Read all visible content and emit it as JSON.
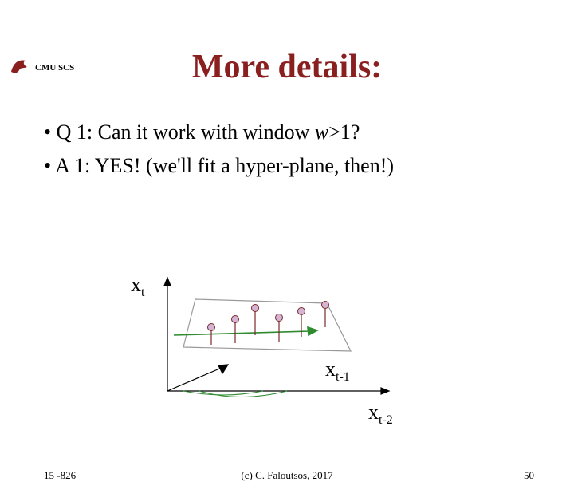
{
  "header": {
    "org": "CMU SCS"
  },
  "title": "More details:",
  "bullets": {
    "q1_prefix": "Q 1: Can it work with window ",
    "q1_var": "w",
    "q1_suffix": ">1?",
    "a1": "A 1: YES! (we'll fit a hyper-plane, then!)"
  },
  "axes": {
    "y_base": "x",
    "y_sub": "t",
    "x1_base": "x",
    "x1_sub": "t-1",
    "x2_base": "x",
    "x2_sub": "t-2"
  },
  "footer": {
    "left": "15 -826",
    "center": "(c) C. Faloutsos, 2017",
    "right": "50"
  },
  "colors": {
    "title": "#8a1f1f",
    "axis": "#000000",
    "plane": "#9a9a9a",
    "arrow_green": "#2e8b2e",
    "point_fill": "#d4b3d4",
    "point_stroke": "#7a2a2a"
  }
}
